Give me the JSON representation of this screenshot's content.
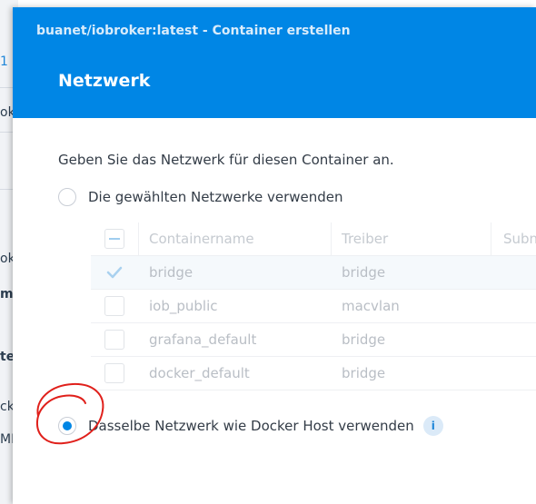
{
  "background": {
    "rows": [
      "1",
      "ok",
      "m",
      "ok",
      "m",
      "te",
      "ck",
      "ME"
    ]
  },
  "dialog": {
    "subtitle": "buanet/iobroker:latest - Container erstellen",
    "title": "Netzwerk",
    "description": "Geben Sie das Netzwerk für diesen Container an.",
    "option_selected_networks": "Die gewählten Netzwerke verwenden",
    "option_host_network": "Dasselbe Netzwerk wie Docker Host verwenden",
    "selected_option": "host",
    "table": {
      "columns": [
        "Containername",
        "Treiber",
        "Subn"
      ],
      "rows": [
        {
          "name": "bridge",
          "driver": "bridge",
          "checked": true
        },
        {
          "name": "iob_public",
          "driver": "macvlan",
          "checked": false
        },
        {
          "name": "grafana_default",
          "driver": "bridge",
          "checked": false
        },
        {
          "name": "docker_default",
          "driver": "bridge",
          "checked": false
        }
      ]
    },
    "info_icon_glyph": "i"
  },
  "colors": {
    "header": "#0086e5",
    "accent": "#0086e5",
    "annotation": "#e0201b"
  }
}
